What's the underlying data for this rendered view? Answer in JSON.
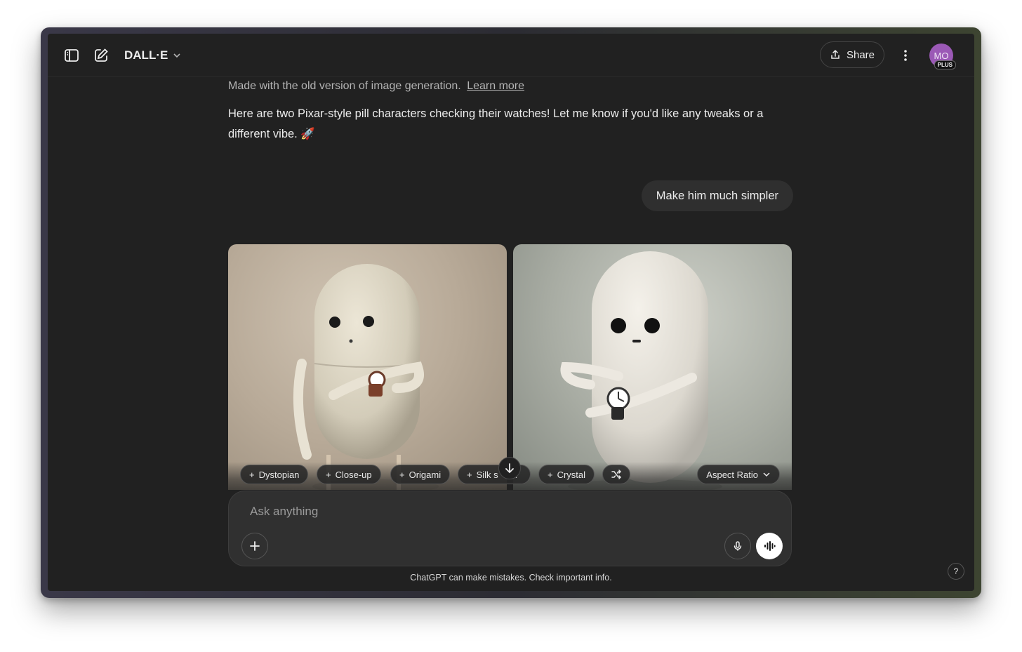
{
  "header": {
    "model_name": "DALL·E",
    "share_label": "Share",
    "avatar_initials": "MO",
    "avatar_badge": "PLUS",
    "avatar_color": "#9b59b6"
  },
  "conversation": {
    "note_text": "Made with the old version of image generation.",
    "note_link": "Learn more",
    "assistant_message": "Here are two Pixar-style pill characters checking their watches! Let me know if you'd like any tweaks or a different vibe. 🚀",
    "user_message": "Make him much simpler"
  },
  "image_toolbar": {
    "chips": [
      "Dystopian",
      "Close-up",
      "Origami",
      "Silk s",
      "n",
      "Crystal"
    ],
    "aspect_ratio_label": "Aspect Ratio"
  },
  "composer": {
    "placeholder": "Ask anything"
  },
  "footer": {
    "disclaimer": "ChatGPT can make mistakes. Check important info.",
    "help_label": "?"
  }
}
